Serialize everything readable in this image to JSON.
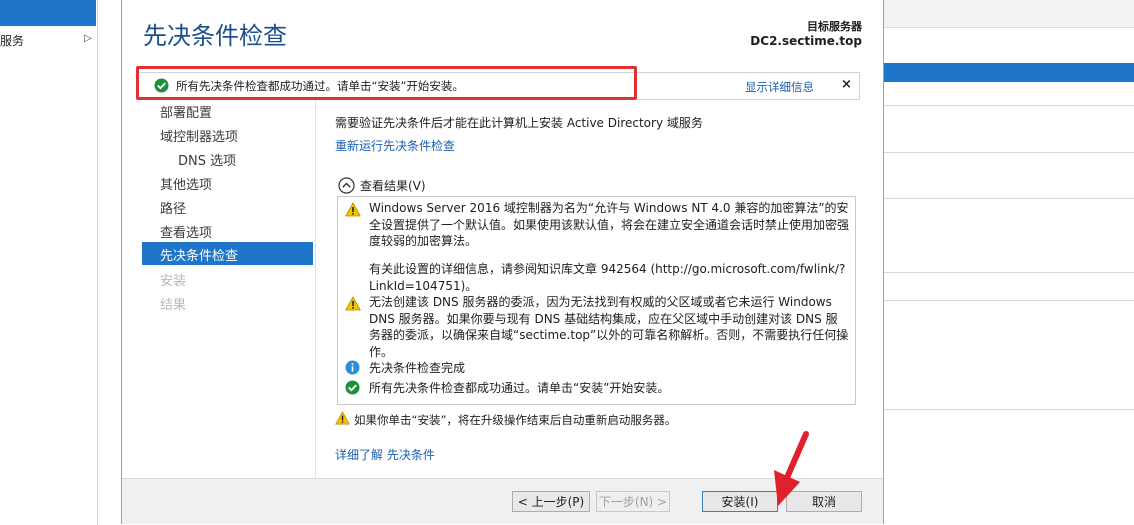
{
  "background": {
    "left_item_label": "服务",
    "accent": "#1f75c7"
  },
  "wizard": {
    "title": "先决条件检查",
    "target_label": "目标服务器",
    "target_name": "DC2.sectime.top",
    "notification": {
      "text": "所有先决条件检查都成功通过。请单击“安装”开始安装。",
      "details_link": "显示详细信息",
      "close": "×"
    },
    "nav": [
      {
        "label": "部署配置"
      },
      {
        "label": "域控制器选项"
      },
      {
        "label": "DNS 选项"
      },
      {
        "label": "其他选项"
      },
      {
        "label": "路径"
      },
      {
        "label": "查看选项"
      },
      {
        "label": "先决条件检查"
      },
      {
        "label": "安装"
      },
      {
        "label": "结果"
      }
    ],
    "intro": "需要验证先决条件后才能在此计算机上安装 Active Directory 域服务",
    "rerun_link": "重新运行先决条件检查",
    "results_label": "查看结果(V)",
    "results": [
      {
        "icon": "warning-icon",
        "text": "Windows Server 2016 域控制器为名为“允许与 Windows NT 4.0 兼容的加密算法”的安全设置提供了一个默认值。如果使用该默认值，将会在建立安全通道会话时禁止使用加密强度较弱的加密算法。"
      },
      {
        "icon": "",
        "text": "有关此设置的详细信息，请参阅知识库文章 942564 (http://go.microsoft.com/fwlink/?LinkId=104751)。"
      },
      {
        "icon": "warning-icon",
        "text": "无法创建该 DNS 服务器的委派，因为无法找到有权威的父区域或者它未运行 Windows DNS 服务器。如果你要与现有 DNS 基础结构集成，应在父区域中手动创建对该 DNS 服务器的委派，以确保来自域“sectime.top”以外的可靠名称解析。否则，不需要执行任何操作。"
      },
      {
        "icon": "info-icon",
        "text": "先决条件检查完成"
      },
      {
        "icon": "success-icon",
        "text": "所有先决条件检查都成功通过。请单击“安装”开始安装。"
      }
    ],
    "footer_warning": "如果你单击“安装”，将在升级操作结束后自动重新启动服务器。",
    "learn_more": "详细了解 先决条件",
    "buttons": {
      "previous": "< 上一步(P)",
      "next": "下一步(N) >",
      "install": "安装(I)",
      "cancel": "取消"
    },
    "colors": {
      "title": "#1b4f8a",
      "link": "#1a5fb4",
      "highlight_box": "#e03030",
      "arrow": "#e0202a",
      "success": "#1e8f3a",
      "warning": "#f5c400",
      "info": "#2a8fd6"
    }
  }
}
